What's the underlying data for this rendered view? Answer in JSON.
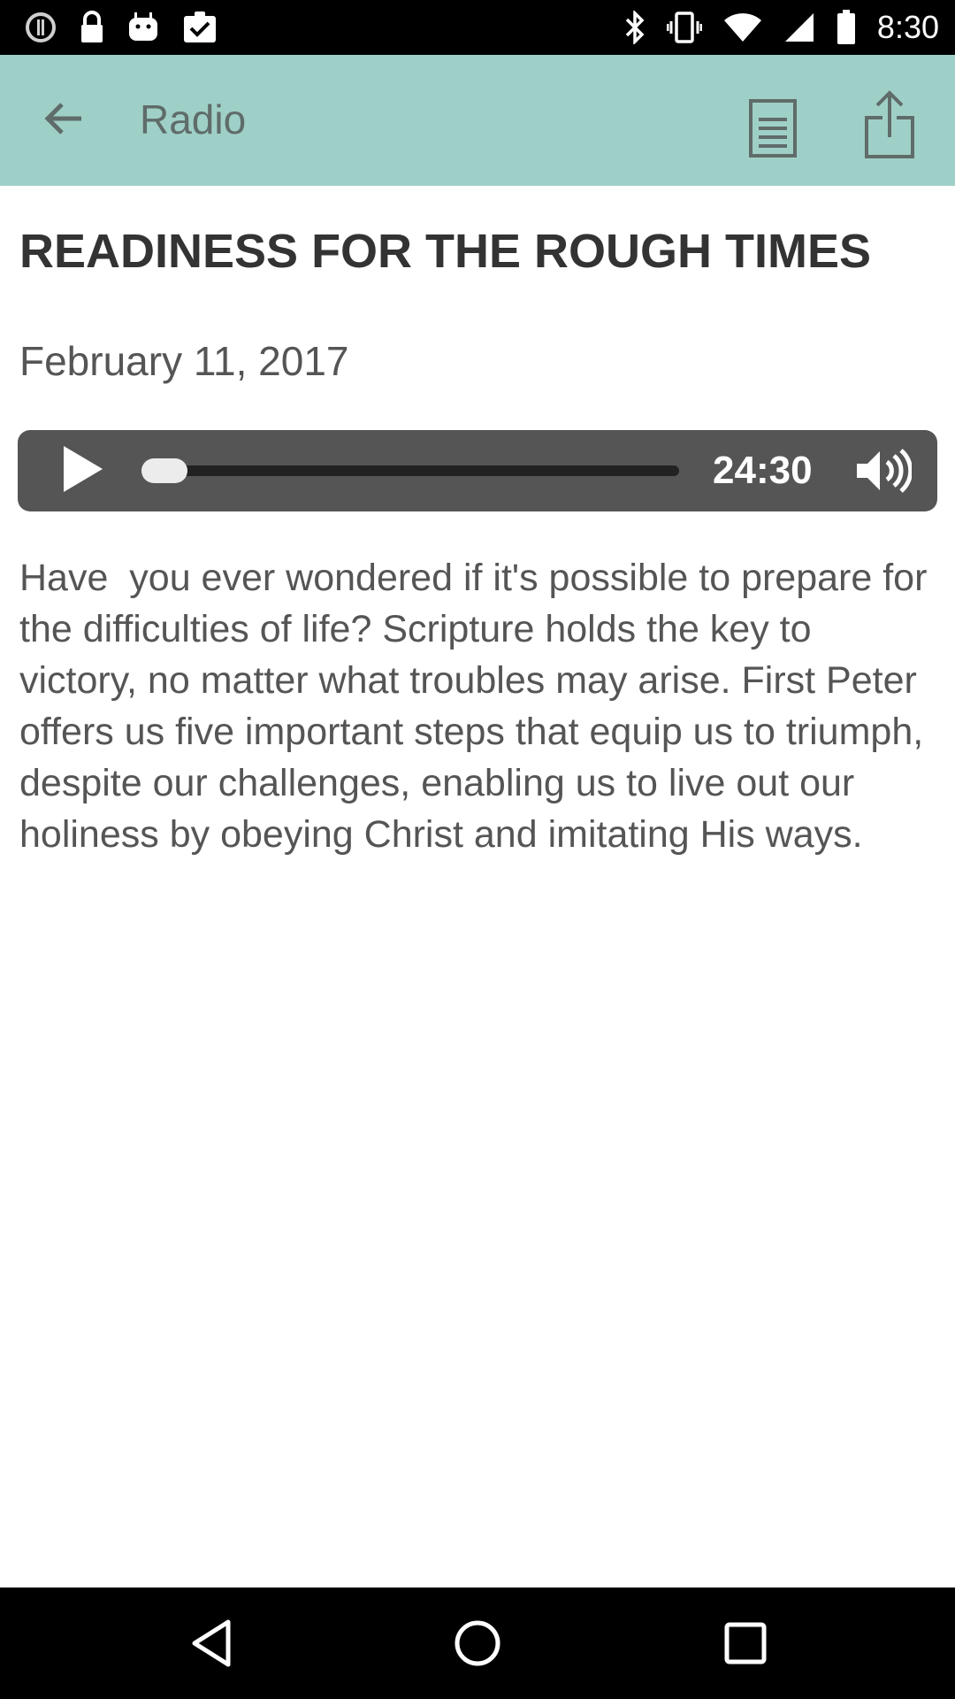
{
  "status_bar": {
    "time": "8:30",
    "left_icons": [
      "alert-circle-icon",
      "lock-icon",
      "android-icon",
      "clipboard-check-icon"
    ],
    "right_icons": [
      "bluetooth-icon",
      "vibrate-icon",
      "wifi-icon",
      "signal-icon",
      "battery-icon"
    ]
  },
  "app_bar": {
    "title": "Radio",
    "background": "#9fd0c7",
    "actions": [
      "document-icon",
      "share-icon"
    ]
  },
  "article": {
    "title": "READINESS FOR THE ROUGH TIMES",
    "date": "February 11, 2017",
    "body": "Have  you ever wondered if it's possible to prepare for the difficulties of life? Scripture holds the key to victory, no matter what troubles may arise. First Peter offers us five important steps that equip us to triumph, despite our challenges, enabling us to live out our holiness by obeying Christ and imitating His ways."
  },
  "player": {
    "duration": "24:30",
    "progress": 0.0,
    "background": "#555555"
  },
  "nav_bar": {
    "buttons": [
      "back-triangle-icon",
      "home-circle-icon",
      "recents-square-icon"
    ]
  }
}
